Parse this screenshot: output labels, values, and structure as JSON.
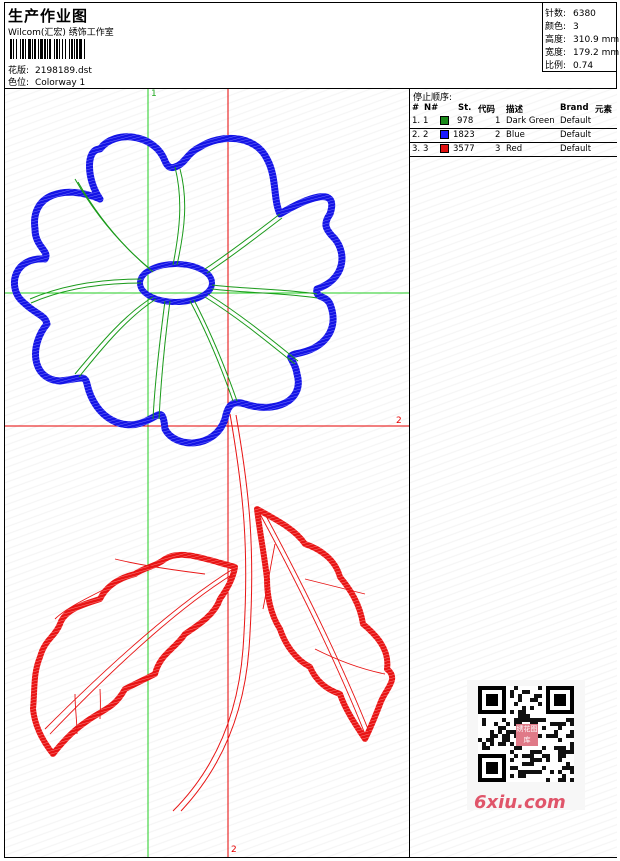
{
  "header": {
    "title": "生产作业图",
    "subtitle": "Wilcom(汇宏) 绣饰工作室",
    "design_label": "花版:",
    "design_value": "2198189.dst",
    "colorway_label": "色位:",
    "colorway_value": "Colorway 1"
  },
  "stats": [
    {
      "label": "针数:",
      "value": "6380"
    },
    {
      "label": "颜色:",
      "value": "3"
    },
    {
      "label": "高度:",
      "value": "310.9 mm"
    },
    {
      "label": "宽度:",
      "value": "179.2 mm"
    },
    {
      "label": "比例:",
      "value": "0.74"
    }
  ],
  "stop_sequence": {
    "title": "停止顺序:",
    "columns": [
      "#",
      "N#",
      "St.",
      "代码",
      "描述",
      "Brand",
      "元素"
    ],
    "rows": [
      {
        "index": "1.",
        "n": "1",
        "color": "#1a8a1a",
        "stitches": "978",
        "code": "1",
        "description": "Dark Green",
        "brand": "Default"
      },
      {
        "index": "2.",
        "n": "2",
        "color": "#1a1aff",
        "stitches": "1823",
        "code": "2",
        "description": "Blue",
        "brand": "Default"
      },
      {
        "index": "3.",
        "n": "3",
        "color": "#e01010",
        "stitches": "3577",
        "code": "3",
        "description": "Red",
        "brand": "Default"
      }
    ]
  },
  "guides": {
    "green_top_label": "1",
    "red_right_label": "2",
    "red_bottom_label": "2"
  },
  "colors": {
    "green": "#1a9a1a",
    "blue": "#1414e6",
    "red": "#e81414",
    "guide_green": "#22cc22",
    "guide_red": "#e60000"
  },
  "watermark": {
    "site": "6xiu.com",
    "seal_text": "绣花图库"
  }
}
